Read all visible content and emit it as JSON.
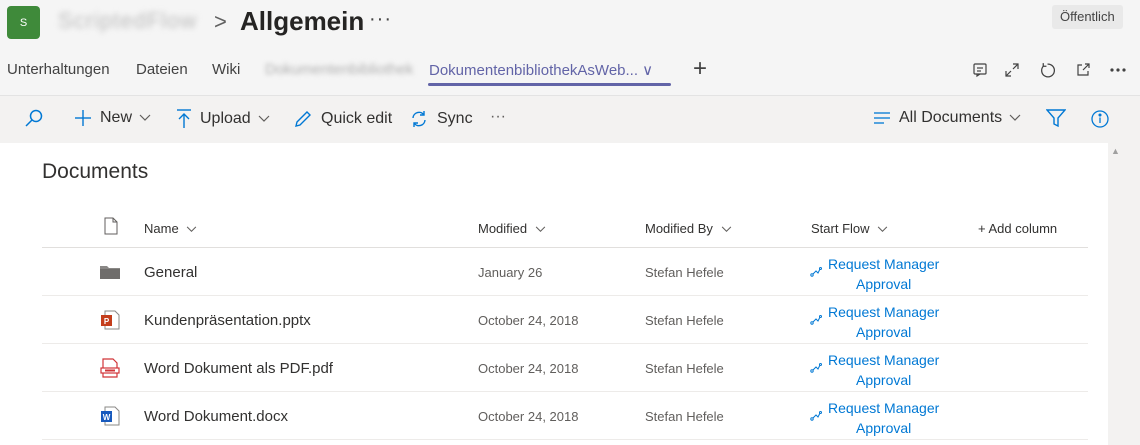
{
  "header": {
    "avatar_initial": "S",
    "team_name": "ScriptedFlow",
    "separator": ">",
    "channel_name": "Allgemein",
    "channel_more": "···",
    "visibility_badge": "Öffentlich"
  },
  "tabs": [
    {
      "label": "Unterhaltungen"
    },
    {
      "label": "Dateien"
    },
    {
      "label": "Wiki"
    },
    {
      "label": "Dokumentenbibliothek"
    },
    {
      "label": "DokumentenbibliothekAsWeb... ∨"
    }
  ],
  "tabbar_icons": [
    "conversation-icon",
    "expand-icon",
    "refresh-icon",
    "popout-icon",
    "more-icon"
  ],
  "commands": {
    "new": "New",
    "upload": "Upload",
    "quick_edit": "Quick edit",
    "sync": "Sync",
    "more": "···",
    "view": "All Documents"
  },
  "library": {
    "title": "Documents",
    "columns": {
      "name": "Name",
      "modified": "Modified",
      "modified_by": "Modified By",
      "start_flow": "Start Flow",
      "add_column": "+ Add column"
    },
    "rows": [
      {
        "type": "folder",
        "name": "General",
        "modified": "January 26",
        "modified_by": "Stefan Hefele",
        "flow_line1": "Request Manager",
        "flow_line2": "Approval"
      },
      {
        "type": "pptx",
        "name": "Kundenpräsentation.pptx",
        "modified": "October 24, 2018",
        "modified_by": "Stefan Hefele",
        "flow_line1": "Request Manager",
        "flow_line2": "Approval"
      },
      {
        "type": "pdf",
        "name": "Word Dokument als PDF.pdf",
        "modified": "October 24, 2018",
        "modified_by": "Stefan Hefele",
        "flow_line1": "Request Manager",
        "flow_line2": "Approval"
      },
      {
        "type": "docx",
        "name": "Word Dokument.docx",
        "modified": "October 24, 2018",
        "modified_by": "Stefan Hefele",
        "flow_line1": "Request Manager",
        "flow_line2": "Approval"
      }
    ]
  },
  "colors": {
    "accent": "#6264a7",
    "link": "#0078d4",
    "team_avatar": "#3f8a3a"
  }
}
